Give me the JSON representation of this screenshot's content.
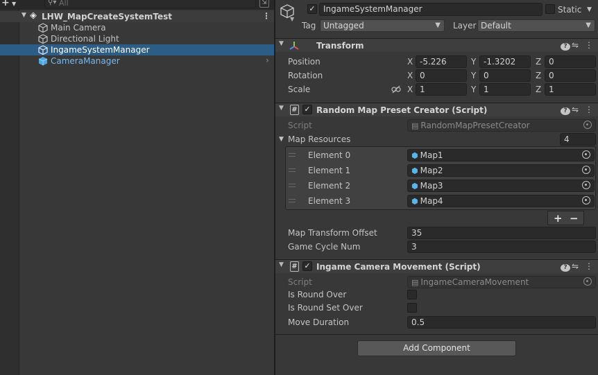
{
  "hierarchy": {
    "add_button": "+",
    "search_placeholder": "All",
    "scene_name": "LHW_MapCreateSystemTest",
    "items": [
      {
        "label": "Main Camera",
        "selected": false,
        "prefab": false
      },
      {
        "label": "Directional Light",
        "selected": false,
        "prefab": false
      },
      {
        "label": "IngameSystemManager",
        "selected": true,
        "prefab": false
      },
      {
        "label": "CameraManager",
        "selected": false,
        "prefab": true
      }
    ]
  },
  "inspector": {
    "object_name": "IngameSystemManager",
    "active": true,
    "static_label": "Static",
    "tag_label": "Tag",
    "tag_value": "Untagged",
    "layer_label": "Layer",
    "layer_value": "Default",
    "transform": {
      "title": "Transform",
      "position_label": "Position",
      "rotation_label": "Rotation",
      "scale_label": "Scale",
      "position": {
        "x": "-5.226",
        "y": "-1.3202",
        "z": "0"
      },
      "rotation": {
        "x": "0",
        "y": "0",
        "z": "0"
      },
      "scale": {
        "x": "1",
        "y": "1",
        "z": "1"
      }
    },
    "axes": {
      "x": "X",
      "y": "Y",
      "z": "Z"
    },
    "random_map": {
      "title": "Random Map Preset Creator (Script)",
      "script_label": "Script",
      "script_value": "RandomMapPresetCreator",
      "map_resources_label": "Map Resources",
      "map_resources_count": "4",
      "elements": [
        {
          "label": "Element 0",
          "value": "Map1"
        },
        {
          "label": "Element 1",
          "value": "Map2"
        },
        {
          "label": "Element 2",
          "value": "Map3"
        },
        {
          "label": "Element 3",
          "value": "Map4"
        }
      ],
      "plus": "+",
      "minus": "−",
      "offset_label": "Map Transform Offset",
      "offset_value": "35",
      "cycle_label": "Game Cycle Num",
      "cycle_value": "3"
    },
    "camera_movement": {
      "title": "Ingame Camera Movement (Script)",
      "script_label": "Script",
      "script_value": "IngameCameraMovement",
      "round_over_label": "Is Round Over",
      "round_set_over_label": "Is Round Set Over",
      "duration_label": "Move Duration",
      "duration_value": "0.5"
    },
    "add_component": "Add Component"
  }
}
